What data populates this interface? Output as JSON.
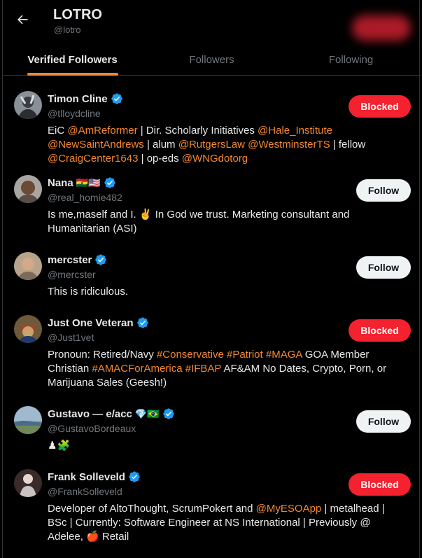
{
  "header": {
    "title": "LOTRO",
    "handle": "@lotro",
    "tabs": [
      {
        "label": "Verified Followers",
        "active": true
      },
      {
        "label": "Followers",
        "active": false
      },
      {
        "label": "Following",
        "active": false
      }
    ]
  },
  "colors": {
    "accent": "#f4882f",
    "blocked": "#f4212e",
    "verified": "#1d9bf0"
  },
  "users": [
    {
      "name": "Timon Cline",
      "handle": "@tlloydcline",
      "button": "Blocked",
      "bio_parts": [
        {
          "t": "EiC ",
          "link": false
        },
        {
          "t": "@AmReformer",
          "link": true
        },
        {
          "t": " | Dir. Scholarly Initiatives ",
          "link": false
        },
        {
          "t": "@Hale_Institute",
          "link": true
        },
        {
          "t": " ",
          "link": false
        },
        {
          "t": "@NewSaintAndrews",
          "link": true
        },
        {
          "t": " | alum ",
          "link": false
        },
        {
          "t": "@RutgersLaw",
          "link": true
        },
        {
          "t": " ",
          "link": false
        },
        {
          "t": "@WestminsterTS",
          "link": true
        },
        {
          "t": " | fellow ",
          "link": false
        },
        {
          "t": "@CraigCenter1643",
          "link": true
        },
        {
          "t": " | op-eds ",
          "link": false
        },
        {
          "t": "@WNGdotorg",
          "link": true
        }
      ]
    },
    {
      "name": "Nana",
      "name_emoji": "🇬🇭🇺🇸",
      "handle": "@real_homie482",
      "button": "Follow",
      "bio_parts": [
        {
          "t": "Is me,maself and I. ✌️ In God we trust. Marketing consultant and Humanitarian (ASI)",
          "link": false
        }
      ]
    },
    {
      "name": "mercster",
      "handle": "@mercster",
      "button": "Follow",
      "bio_parts": [
        {
          "t": "This is ridiculous.",
          "link": false
        }
      ]
    },
    {
      "name": "Just One Veteran",
      "handle": "@Just1vet",
      "button": "Blocked",
      "bio_parts": [
        {
          "t": "Pronoun: Retired/Navy ",
          "link": false
        },
        {
          "t": "#Conservative",
          "link": true
        },
        {
          "t": " ",
          "link": false
        },
        {
          "t": "#Patriot",
          "link": true
        },
        {
          "t": " ",
          "link": false
        },
        {
          "t": "#MAGA",
          "link": true
        },
        {
          "t": " GOA Member Christian ",
          "link": false
        },
        {
          "t": "#AMACForAmerica",
          "link": true
        },
        {
          "t": " ",
          "link": false
        },
        {
          "t": "#IFBAP",
          "link": true
        },
        {
          "t": " AF&AM No Dates, Crypto, Porn, or Marijuana Sales (Geesh!)",
          "link": false
        }
      ]
    },
    {
      "name": "Gustavo — e/acc",
      "name_emoji": "💎🇧🇷",
      "handle": "@GustavoBordeaux",
      "button": "Follow",
      "bio_parts": [
        {
          "t": "♟🧩",
          "link": false
        }
      ]
    },
    {
      "name": "Frank Solleveld",
      "handle": "@FrankSolleveld",
      "button": "Blocked",
      "bio_parts": [
        {
          "t": "Developer of AltoThought, ScrumPokert and ",
          "link": false
        },
        {
          "t": "@MyESOApp",
          "link": true
        },
        {
          "t": " | metalhead | BSc | Currently: Software Engineer at NS International | Previously @ Adelee, 🍎 Retail",
          "link": false
        }
      ]
    }
  ]
}
